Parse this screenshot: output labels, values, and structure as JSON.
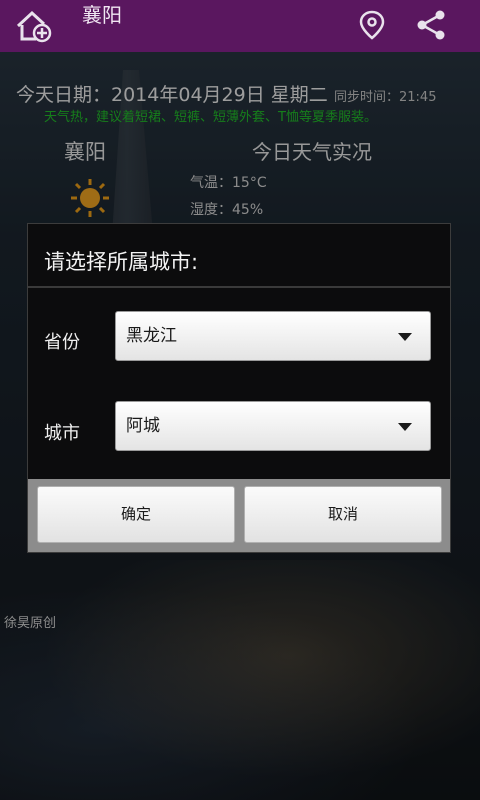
{
  "appbar": {
    "title": "襄阳",
    "home_icon": "home-add-icon",
    "location_icon": "location-pin-icon",
    "share_icon": "share-icon",
    "color": "#5a175f"
  },
  "background": {
    "date_line": "今天日期：2014年04月29日 星期二",
    "sync_time": "同步时间：21:45",
    "advice": "天气热，建议着短裙、短裤、短薄外套、T恤等夏季服装。",
    "city": "襄阳",
    "today_title": "今日天气实况",
    "weather_icon": "sun-icon",
    "temperature": "气温：15°C",
    "humidity": "湿度：45%",
    "credit": "徐昊原创"
  },
  "dialog": {
    "title": "请选择所属城市:",
    "province_label": "省份",
    "province_value": "黑龙江",
    "city_label": "城市",
    "city_value": "阿城",
    "ok_label": "确定",
    "cancel_label": "取消"
  }
}
